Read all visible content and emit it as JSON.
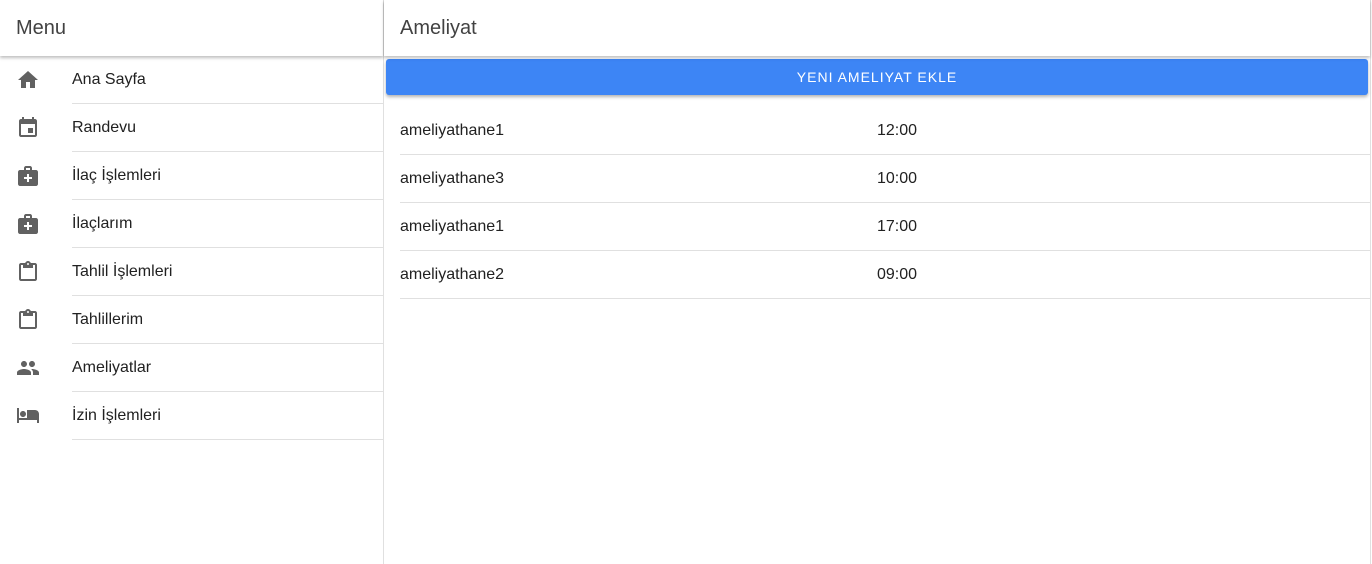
{
  "sidebar": {
    "title": "Menu",
    "items": [
      {
        "label": "Ana Sayfa",
        "icon": "home-icon"
      },
      {
        "label": "Randevu",
        "icon": "calendar-icon"
      },
      {
        "label": "İlaç İşlemleri",
        "icon": "medical-bag-icon"
      },
      {
        "label": "İlaçlarım",
        "icon": "medical-bag-icon"
      },
      {
        "label": "Tahlil İşlemleri",
        "icon": "clipboard-icon"
      },
      {
        "label": "Tahlillerim",
        "icon": "clipboard-icon"
      },
      {
        "label": "Ameliyatlar",
        "icon": "people-icon"
      },
      {
        "label": "İzin İşlemleri",
        "icon": "bed-icon"
      }
    ]
  },
  "main": {
    "title": "Ameliyat",
    "add_button_label": "YENI AMELIYAT EKLE",
    "accent_color": "#3d85f5",
    "rows": [
      {
        "room": "ameliyathane1",
        "time": "12:00"
      },
      {
        "room": "ameliyathane3",
        "time": "10:00"
      },
      {
        "room": "ameliyathane1",
        "time": "17:00"
      },
      {
        "room": "ameliyathane2",
        "time": "09:00"
      }
    ]
  }
}
